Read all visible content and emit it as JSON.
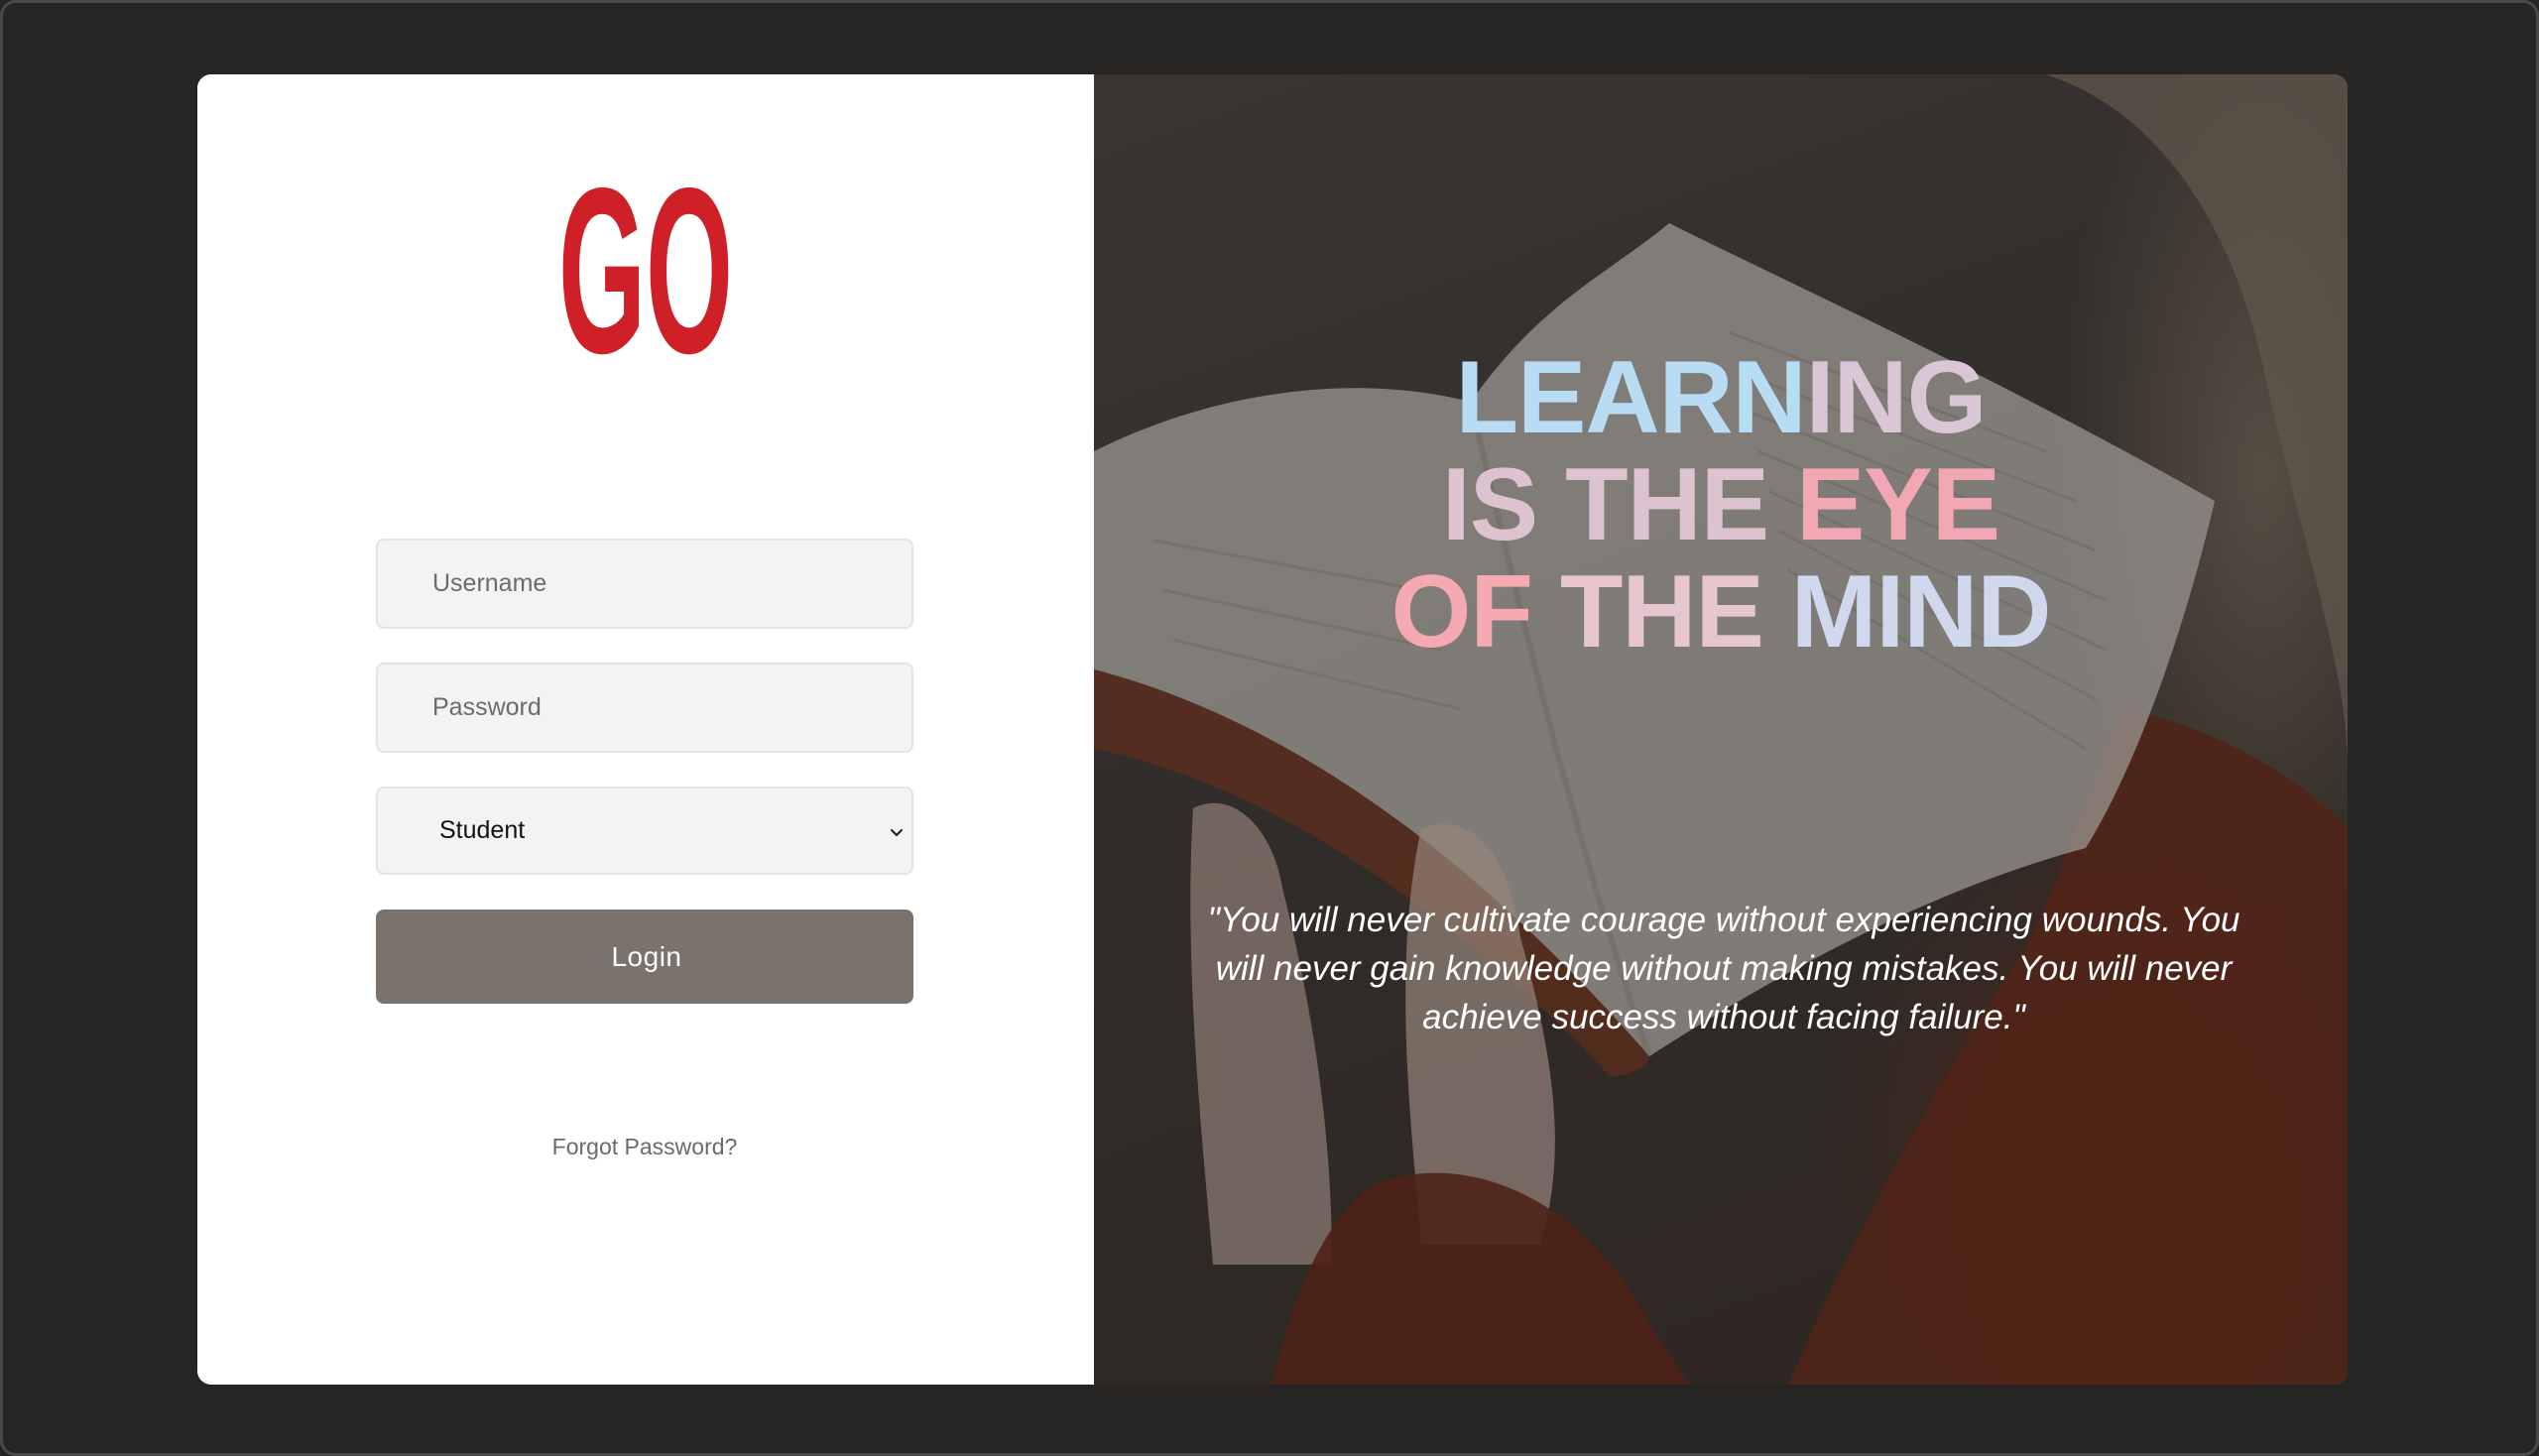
{
  "brand": {
    "logo_text": "GO",
    "logo_color": "#cf2027"
  },
  "login_form": {
    "username_placeholder": "Username",
    "password_placeholder": "Password",
    "role_selected": "Student",
    "login_label": "Login",
    "forgot_password_label": "Forgot Password?"
  },
  "hero": {
    "headline": {
      "line1": [
        {
          "text": "LEARN",
          "color": "#b9dcf5"
        },
        {
          "text": "ING",
          "color": "#d9c6d6"
        }
      ],
      "line2": [
        {
          "text": "IS THE ",
          "color": "#dcc3cf"
        },
        {
          "text": "EYE",
          "color": "#f2a8b2"
        }
      ],
      "line3": [
        {
          "text": "OF ",
          "color": "#f5a9b0"
        },
        {
          "text": "THE ",
          "color": "#e6c6cf"
        },
        {
          "text": "MIND",
          "color": "#cfd8ec"
        }
      ]
    },
    "quote": "\"You will never cultivate courage without experiencing wounds. You will never gain knowledge without making mistakes. You will never achieve success without facing failure.\""
  },
  "colors": {
    "page_background": "#262524",
    "login_button": "#7a736d",
    "field_background": "#f3f3f3"
  }
}
